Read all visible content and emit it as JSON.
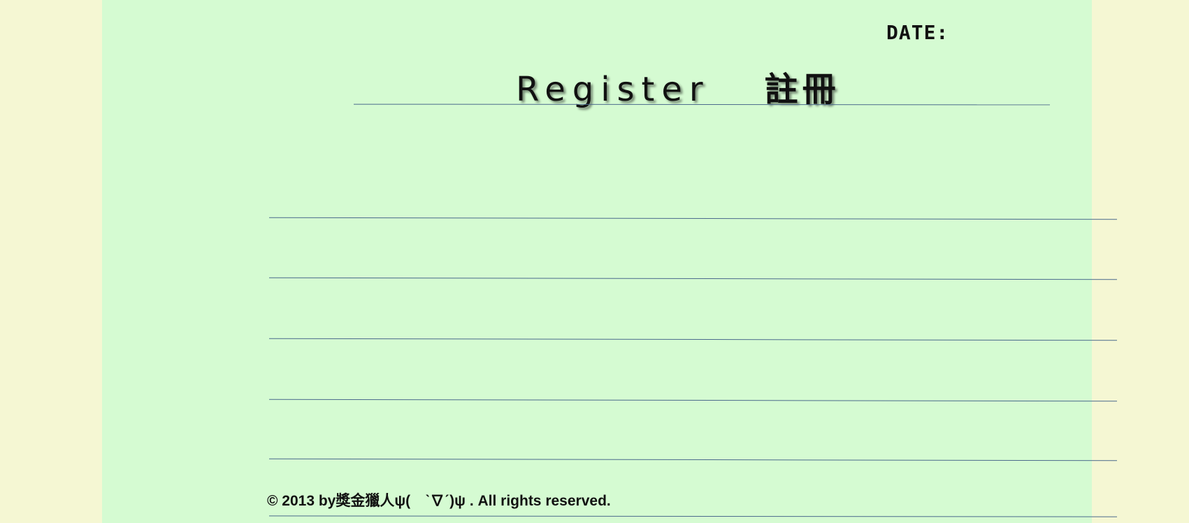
{
  "header": {
    "date_label": "DATE:"
  },
  "title": {
    "english": "Register",
    "chinese": "註冊"
  },
  "footer": {
    "copyright": "© 2013 by獎金獵人ψ(　ˋ∇ˊ)ψ . All rights reserved."
  },
  "colors": {
    "outer_background": "#f5f7d3",
    "page_background": "#d5fbd2",
    "rule_color": "#4b6a8c",
    "text_color": "#111111"
  }
}
